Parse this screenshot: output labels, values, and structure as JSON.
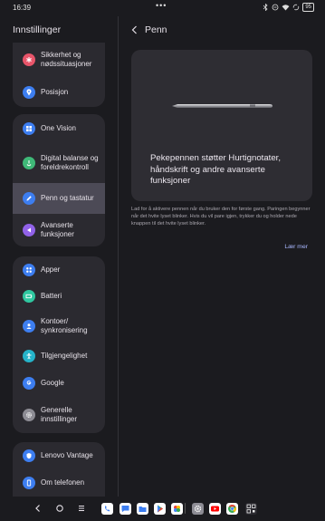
{
  "status_bar": {
    "time": "16:39",
    "dots": "•••",
    "icons": [
      "bluetooth-icon",
      "do-not-disturb-icon",
      "wifi-icon",
      "sync-icon"
    ],
    "battery": "95"
  },
  "sidebar": {
    "title": "Innstillinger",
    "groups": [
      {
        "items": [
          {
            "label": "Sikkerhet og nødssituasjoner",
            "icon": "emergency-icon",
            "color": "#e8556a"
          },
          {
            "label": "Posisjon",
            "icon": "location-icon",
            "color": "#3d7ef0"
          }
        ]
      },
      {
        "items": [
          {
            "label": "One Vision",
            "icon": "one-vision-icon",
            "color": "#3d7ef0"
          },
          {
            "label": "Digital balanse og foreldrekontroll",
            "icon": "digital-wellbeing-icon",
            "color": "#3fb978"
          },
          {
            "label": "Penn og tastatur",
            "icon": "pen-icon",
            "color": "#3d7ef0",
            "active": true
          },
          {
            "label": "Avanserte funksjoner",
            "icon": "advanced-features-icon",
            "color": "#9162e8"
          }
        ]
      },
      {
        "items": [
          {
            "label": "Apper",
            "icon": "apps-icon",
            "color": "#3d7ef0"
          },
          {
            "label": "Batteri",
            "icon": "battery-icon",
            "color": "#2fc7a0"
          },
          {
            "label": "Kontoer/ synkronisering",
            "icon": "accounts-icon",
            "color": "#3d7ef0"
          },
          {
            "label": "Tilgjengelighet",
            "icon": "accessibility-icon",
            "color": "#25b3c9"
          },
          {
            "label": "Google",
            "icon": "google-icon",
            "color": "#3d7ef0"
          },
          {
            "label": "Generelle innstillinger",
            "icon": "general-settings-icon",
            "color": "#8d8c94"
          }
        ]
      },
      {
        "items": [
          {
            "label": "Lenovo Vantage",
            "icon": "lenovo-vantage-icon",
            "color": "#3d7ef0"
          },
          {
            "label": "Om telefonen",
            "icon": "about-phone-icon",
            "color": "#3d7ef0"
          }
        ]
      }
    ]
  },
  "detail": {
    "title": "Penn",
    "card_text": "Pekepennen støtter Hurtignotater, håndskrift og andre avanserte funksjoner",
    "info_text": "Lad for å aktivere pennen når du bruker den for første gang. Paringen begynner når det hvite lyset blinker. Hvis du vil pare igjen, trykker du og holder nede knappen til det hvite lyset blinker.",
    "learn_more": "Lær mer"
  },
  "navbar": {
    "buttons": [
      "back-icon",
      "home-icon",
      "recents-icon"
    ],
    "dock_apps": [
      "phone-app-icon",
      "messages-app-icon",
      "files-app-icon",
      "play-store-app-icon",
      "photos-app-icon",
      "settings-app-icon",
      "youtube-app-icon",
      "chrome-app-icon",
      "qr-app-icon"
    ]
  }
}
